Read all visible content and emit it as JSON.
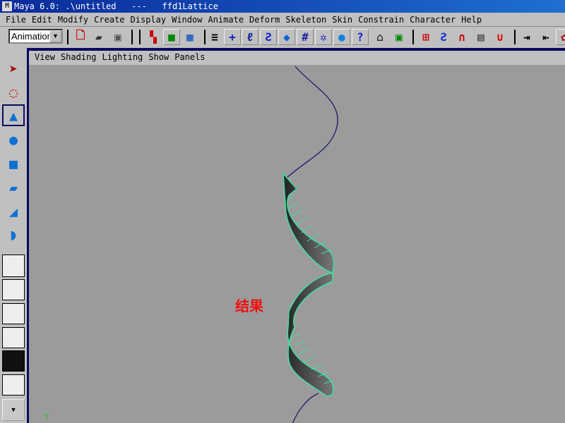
{
  "window": {
    "title": "Maya 6.0: .\\untitled   ---   ffd1Lattice",
    "logo": "M"
  },
  "menu": [
    "File",
    "Edit",
    "Modify",
    "Create",
    "Display",
    "Window",
    "Animate",
    "Deform",
    "Skeleton",
    "Skin",
    "Constrain",
    "Character",
    "Help"
  ],
  "toolbar": {
    "menu_set": "Animation",
    "icons": [
      "new-scene-icon",
      "open-scene-icon",
      "save-scene-icon",
      "select-hierarchy-icon",
      "select-object-icon",
      "select-component-icon",
      "snap-toggle-icon",
      "add-icon",
      "joint-icon",
      "curve-icon",
      "surface-icon",
      "lattice-icon",
      "light-icon",
      "sphere-icon",
      "help-icon",
      "lock-icon",
      "select-highlight-icon",
      "snap-grid-icon",
      "snap-curve-icon",
      "snap-point-icon",
      "snap-plane-icon",
      "snap-live-icon",
      "input-icon",
      "output-icon",
      "render-icon"
    ]
  },
  "panel": {
    "menu": [
      "View",
      "Shading",
      "Lighting",
      "Show",
      "Panels"
    ],
    "annotation": "结果"
  },
  "toolbox": [
    "select-tool-icon",
    "lasso-tool-icon",
    "move-tool-icon",
    "rotate-tool-icon",
    "scale-tool-icon",
    "manipulator-icon",
    "soft-mod-icon",
    "last-tool-icon"
  ],
  "colors": {
    "wireframe": "#40e0a0",
    "curve": "#1a1a6a",
    "label": "#f01010",
    "viewport": "#9b9b9b"
  }
}
